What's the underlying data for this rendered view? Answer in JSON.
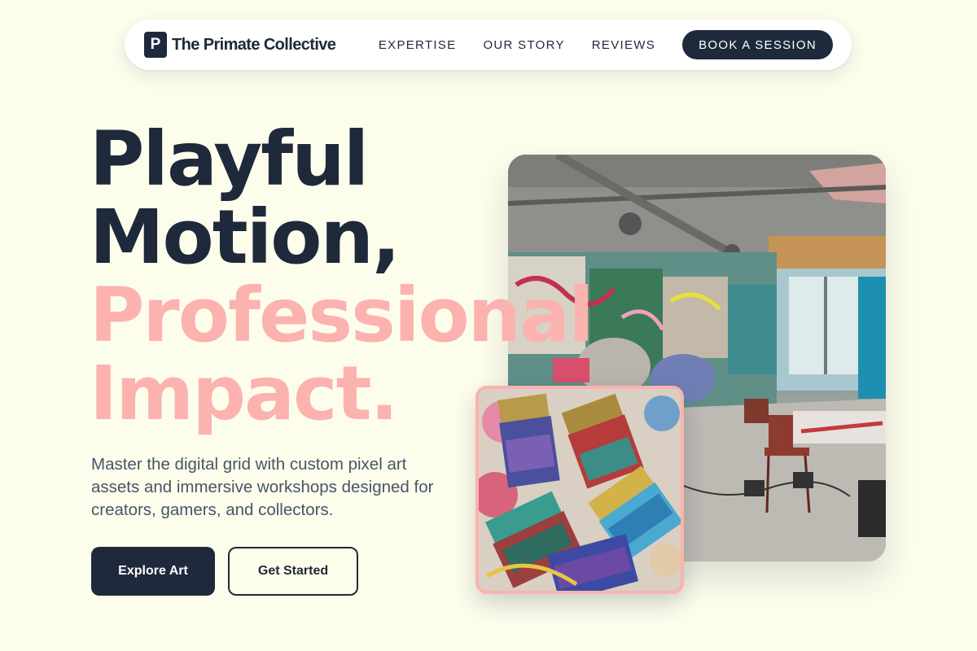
{
  "brand": {
    "mark": "P",
    "name": "The Primate Collective"
  },
  "nav": {
    "links": [
      "EXPERTISE",
      "OUR STORY",
      "REVIEWS"
    ],
    "cta": "BOOK A SESSION"
  },
  "hero": {
    "headline": [
      "Playful",
      "Motion,",
      "Professional",
      "Impact."
    ],
    "subtitle": "Master the digital grid with custom pixel art assets and immersive workshops designed for creators, gamers, and collectors.",
    "primary_button": "Explore Art",
    "secondary_button": "Get Started"
  },
  "colors": {
    "background": "#fdfdec",
    "dark": "#1e293b",
    "accent_pink": "#fcb2ae",
    "body_text": "#475569"
  },
  "images": {
    "main": "graffiti-studio-photo",
    "inset": "paint-brushes-photo"
  }
}
